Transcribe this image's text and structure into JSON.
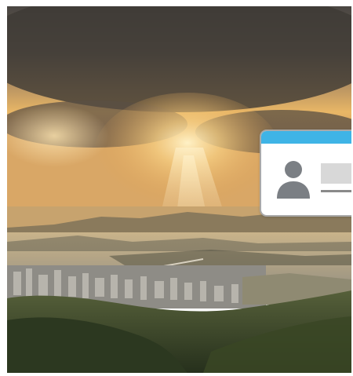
{
  "scene": {
    "photo_icon": "landscape-photo",
    "colors": {
      "sky_dark": "#4a4642",
      "sky_glow": "#f6c46a",
      "water": "#b9a98a",
      "hills": "#3d4a2a"
    }
  },
  "contact_card": {
    "icon": "user-avatar-icon",
    "header_color": "#3fb4e6",
    "border_color": "#a9a9a9",
    "placeholder_color": "#d8d8d8"
  }
}
